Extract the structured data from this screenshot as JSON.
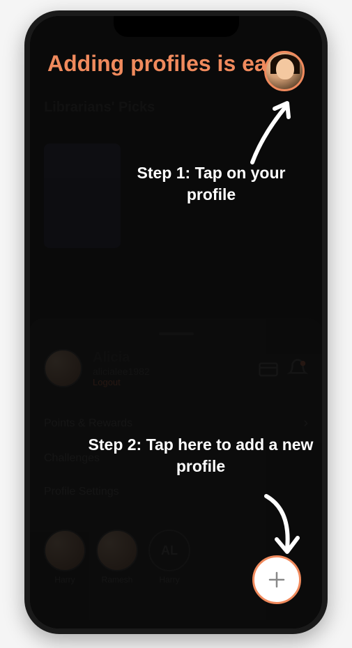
{
  "overlay": {
    "headline": "Adding profiles is easy!",
    "step1": "Step 1: Tap on your profile",
    "step2": "Step 2: Tap here to add a new profile"
  },
  "background": {
    "section_title": "Librarians' Picks",
    "ecard_label": "eCard"
  },
  "sheet": {
    "user": {
      "name": "Alicia",
      "handle": "alicialee1982",
      "logout": "Logout"
    },
    "menu": {
      "points": "Points & Rewards",
      "challenges": "Challenges",
      "settings": "Profile Settings"
    },
    "profiles": [
      {
        "label": "Harry",
        "type": "avatar"
      },
      {
        "label": "Ramesh",
        "type": "avatar"
      },
      {
        "label": "Harry",
        "type": "initials",
        "initials": "AL"
      },
      {
        "label": "Add",
        "type": "add"
      }
    ]
  },
  "colors": {
    "accent": "#f08a5d"
  }
}
